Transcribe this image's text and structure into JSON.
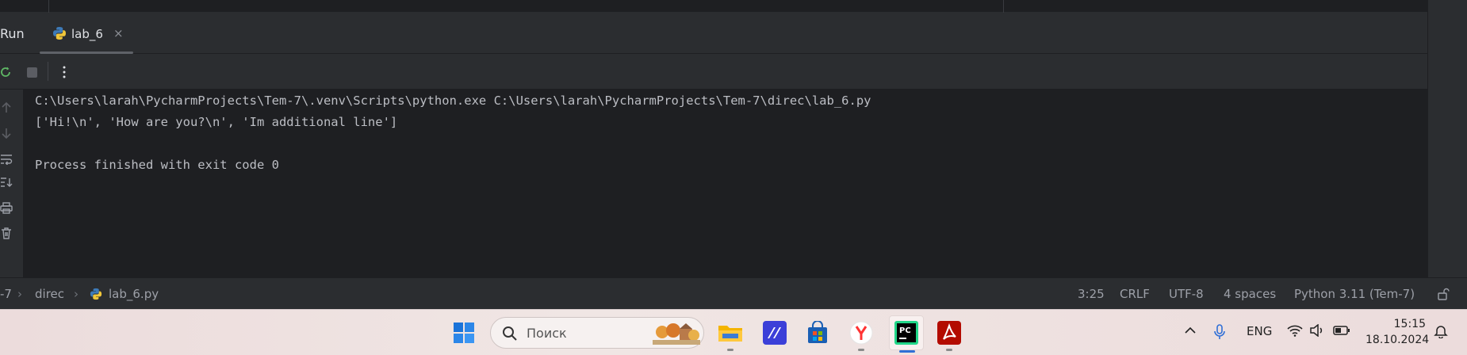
{
  "run_panel": {
    "title": "Run",
    "tab": {
      "label": "lab_6",
      "close": "×"
    }
  },
  "console": {
    "lines": [
      "C:\\Users\\larah\\PycharmProjects\\Tem-7\\.venv\\Scripts\\python.exe C:\\Users\\larah\\PycharmProjects\\Tem-7\\direc\\lab_6.py",
      "['Hi!\\n', 'How are you?\\n', 'Im additional line']",
      "",
      "Process finished with exit code 0"
    ]
  },
  "statusbar": {
    "breadcrumb": [
      "-7",
      "direc",
      "lab_6.py"
    ],
    "position": "3:25",
    "line_sep": "CRLF",
    "encoding": "UTF-8",
    "indent": "4 spaces",
    "interpreter": "Python 3.11 (Tem-7)"
  },
  "taskbar": {
    "search_placeholder": "Поиск",
    "language": "ENG",
    "time": "15:15",
    "date": "18.10.2024"
  },
  "icons": {
    "rerun": "rerun-icon",
    "stop": "stop-icon",
    "more": "more-vertical-icon"
  },
  "colors": {
    "accent_green": "#5fb865",
    "python_blue": "#3d7ab8",
    "python_yellow": "#f0c63a"
  }
}
